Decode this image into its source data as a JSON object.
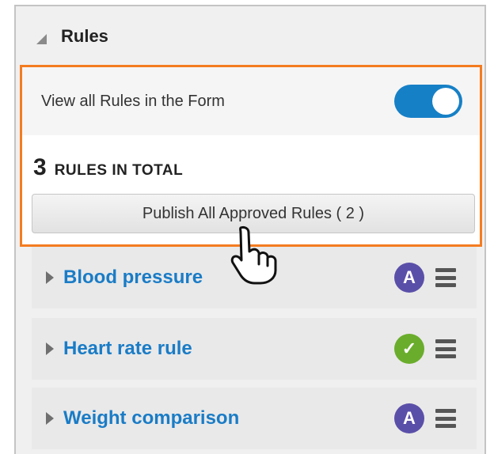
{
  "panel": {
    "title": "Rules",
    "toggle": {
      "label": "View all Rules in the Form",
      "state": "on"
    },
    "total": {
      "count": "3",
      "label": "RULES IN TOTAL"
    },
    "publish_button": "Publish All Approved Rules ( 2 )"
  },
  "rules": [
    {
      "name": "Blood pressure",
      "status_icon": "approved-a-badge",
      "status_text": "A"
    },
    {
      "name": "Heart rate rule",
      "status_icon": "check-circle-icon",
      "status_text": "✓"
    },
    {
      "name": "Weight comparison",
      "status_icon": "approved-a-badge",
      "status_text": "A"
    }
  ],
  "colors": {
    "highlight": "#f47c20",
    "toggle_on": "#1680c6",
    "rule_link": "#1a7cc6",
    "badge_approved": "#5a4fa8",
    "badge_check": "#6aad2c"
  }
}
